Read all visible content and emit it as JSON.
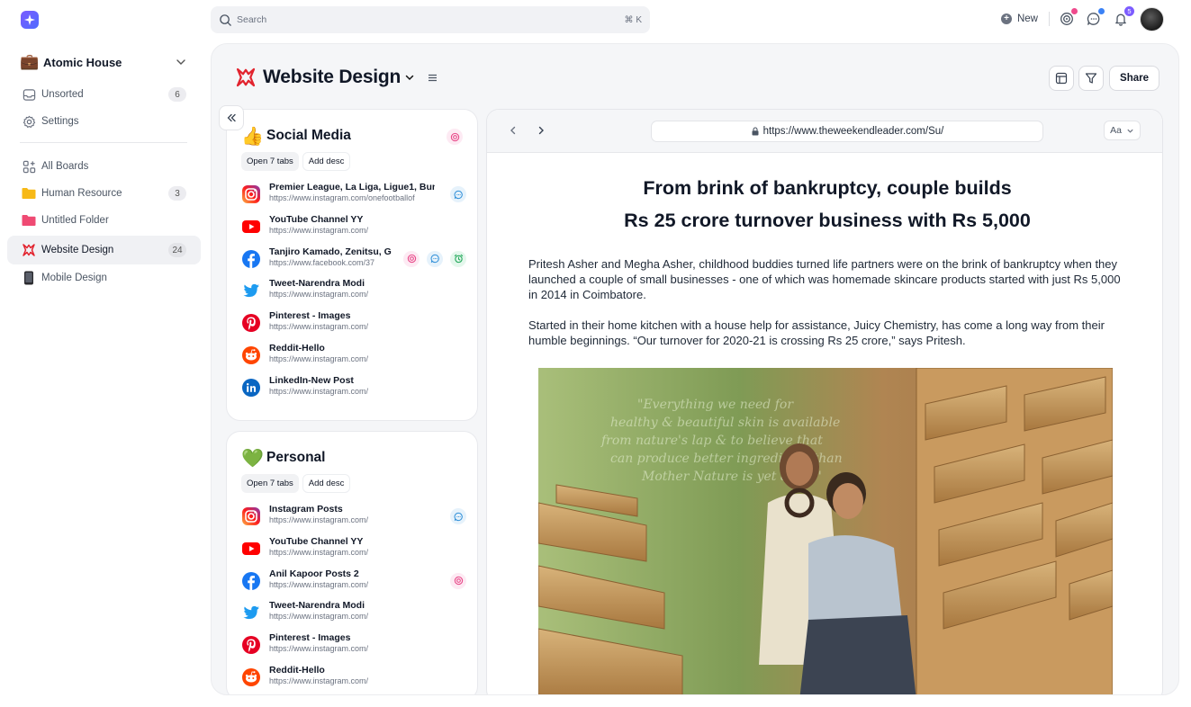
{
  "sidebar": {
    "workspace_icon": "briefcase",
    "workspace_name": "Atomic House",
    "items_top": [
      {
        "icon": "inbox-icon",
        "label": "Unsorted",
        "count": "6"
      },
      {
        "icon": "gear-icon",
        "label": "Settings",
        "count": ""
      }
    ],
    "items_boards": [
      {
        "icon": "grid-icon",
        "label": "All Boards",
        "count": ""
      },
      {
        "icon": "folder-icon",
        "label": "Human Resource",
        "count": "3",
        "color": "#f7b916"
      },
      {
        "icon": "folder-icon",
        "label": "Untitled Folder",
        "count": "",
        "color": "#ef4a73"
      },
      {
        "icon": "website-design-icon",
        "label": "Website Design",
        "count": "24",
        "active": true
      },
      {
        "icon": "phone-icon",
        "label": "Mobile Design",
        "count": ""
      }
    ]
  },
  "topbar": {
    "search_placeholder": "Search",
    "shortcut": "⌘ K",
    "new_label": "New",
    "notification_count": "5"
  },
  "board": {
    "title": "Website Design",
    "share_label": "Share"
  },
  "cards": [
    {
      "emoji": "👍",
      "title": "Social Media",
      "open_tabs_label": "Open 7 tabs",
      "add_desc_label": "Add desc",
      "links": [
        {
          "site": "instagram",
          "title": "Premier League, La Liga, Ligue1, Bun",
          "url": "https://www.instagram.com/onefootballof",
          "actions": [
            "comment"
          ]
        },
        {
          "site": "youtube",
          "title": "YouTube Channel YY",
          "url": "https://www.instagram.com/",
          "actions": []
        },
        {
          "site": "facebook",
          "title": "Tanjiro Kamado, Zenitsu, G",
          "url": "https://www.facebook.com/37",
          "actions": [
            "target",
            "comment",
            "alarm"
          ]
        },
        {
          "site": "twitter",
          "title": "Tweet-Narendra Modi",
          "url": "https://www.instagram.com/",
          "actions": []
        },
        {
          "site": "pinterest",
          "title": "Pinterest - Images",
          "url": "https://www.instagram.com/",
          "actions": []
        },
        {
          "site": "reddit",
          "title": "Reddit-Hello",
          "url": "https://www.instagram.com/",
          "actions": []
        },
        {
          "site": "linkedin",
          "title": "LinkedIn-New Post",
          "url": "https://www.instagram.com/",
          "actions": []
        }
      ]
    },
    {
      "emoji": "💚",
      "title": "Personal",
      "open_tabs_label": "Open 7 tabs",
      "add_desc_label": "Add desc",
      "links": [
        {
          "site": "instagram",
          "title": "Instagram Posts",
          "url": "https://www.instagram.com/",
          "actions": [
            "comment"
          ]
        },
        {
          "site": "youtube",
          "title": "YouTube Channel YY",
          "url": "https://www.instagram.com/",
          "actions": []
        },
        {
          "site": "facebook",
          "title": "Anil Kapoor Posts 2",
          "url": "https://www.instagram.com/",
          "actions": [
            "target"
          ]
        },
        {
          "site": "twitter",
          "title": "Tweet-Narendra Modi",
          "url": "https://www.instagram.com/",
          "actions": []
        },
        {
          "site": "pinterest",
          "title": "Pinterest - Images",
          "url": "https://www.instagram.com/",
          "actions": []
        },
        {
          "site": "reddit",
          "title": "Reddit-Hello",
          "url": "https://www.instagram.com/",
          "actions": []
        }
      ]
    }
  ],
  "browser": {
    "url": "https://www.theweekendleader.com/Su/",
    "reader_label": "Aa",
    "headline_line1": "From brink of bankruptcy, couple builds",
    "headline_line2": "Rs 25 crore turnover business with Rs 5,000",
    "paragraph1": "Pritesh Asher and Megha Asher, childhood buddies turned life partners were on the brink of bankruptcy when they launched a couple of small businesses - one of which was homemade skincare products started with just Rs 5,000 in 2014 in Coimbatore.",
    "paragraph2": "Started in their home kitchen with a house help for assistance, Juicy Chemistry, has come a long way from their humble beginnings. “Our turnover for 2020-21 is crossing Rs 25 crore,” says Pritesh."
  }
}
